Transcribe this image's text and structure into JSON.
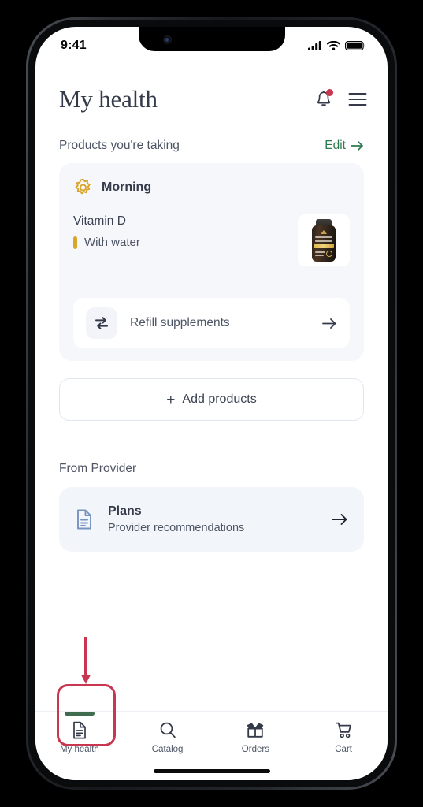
{
  "status_bar": {
    "time": "9:41",
    "icons": [
      "signal-bars-icon",
      "wifi-icon",
      "battery-icon"
    ]
  },
  "header": {
    "title": "My health",
    "notifications_icon": "bell-icon",
    "has_notification_badge": true,
    "menu_icon": "hamburger-menu-icon"
  },
  "sections": {
    "products": {
      "title": "Products you're taking",
      "edit_label": "Edit",
      "edit_arrow": "arrow-right-icon",
      "edit_color": "#2e7a4f",
      "schedule": {
        "icon": "sun-icon",
        "icon_color": "#d9a52c",
        "label": "Morning",
        "product": {
          "name": "Vitamin D",
          "note": "With water",
          "note_marker_color": "#d9a52c",
          "thumbnail": "supplement-bottle-image"
        }
      },
      "refill": {
        "icon": "refresh-repeat-icon",
        "label": "Refill supplements",
        "arrow": "arrow-right-icon"
      },
      "add_products": {
        "plus": "+",
        "label": "Add products"
      }
    },
    "provider": {
      "title": "From Provider",
      "card": {
        "icon": "document-icon",
        "icon_color": "#6b8cbb",
        "title": "Plans",
        "subtitle": "Provider recommendations",
        "arrow": "arrow-right-icon"
      }
    }
  },
  "bottom_nav": {
    "active_index": 0,
    "active_indicator_color": "#3f6b4e",
    "items": [
      {
        "label": "My health",
        "icon": "document-icon",
        "active": true
      },
      {
        "label": "Catalog",
        "icon": "search-icon",
        "active": false
      },
      {
        "label": "Orders",
        "icon": "open-box-icon",
        "active": false
      },
      {
        "label": "Cart",
        "icon": "shopping-cart-icon",
        "active": false
      }
    ]
  },
  "annotations": {
    "highlight_color": "#c8374f",
    "highlight_target": "My health",
    "arrow_direction": "down"
  }
}
